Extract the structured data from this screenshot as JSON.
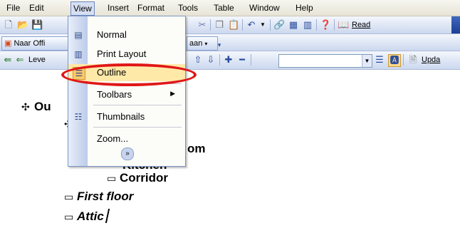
{
  "menubar": {
    "items": [
      "File",
      "Edit",
      "View",
      "Insert",
      "Format",
      "Tools",
      "Table",
      "Window",
      "Help"
    ],
    "active": "View"
  },
  "toolbar": {
    "read_label": "Read",
    "naar_label": "Naar Offi",
    "lijst_label": "aan",
    "level_label": "Leve",
    "update_label": "Upda"
  },
  "view_menu": {
    "items": [
      {
        "label": "Normal",
        "icon": "normal-view-icon"
      },
      {
        "label": "Print Layout",
        "icon": "print-layout-icon"
      },
      {
        "label": "Outline",
        "icon": "outline-view-icon",
        "highlighted": true
      },
      {
        "label": "Toolbars",
        "icon": "",
        "submenu": true
      },
      {
        "label": "Thumbnails",
        "icon": "thumbnails-icon"
      },
      {
        "label": "Zoom...",
        "icon": ""
      }
    ],
    "expand_icon": "chevron-double-down-icon",
    "annotation_color": "#e01717"
  },
  "document": {
    "lines": [
      {
        "text": "Ou",
        "level": 1,
        "symbol": "plus"
      },
      {
        "text": "om",
        "level": 3,
        "symbol": "none"
      },
      {
        "text": "Kitchen",
        "level": 3,
        "symbol": "none"
      },
      {
        "text": "Corridor",
        "level": 3,
        "symbol": "minus"
      },
      {
        "text": "First floor",
        "level": 2,
        "symbol": "minus",
        "italic": true
      },
      {
        "text": "Attic",
        "level": 2,
        "symbol": "minus",
        "italic": true
      }
    ]
  }
}
